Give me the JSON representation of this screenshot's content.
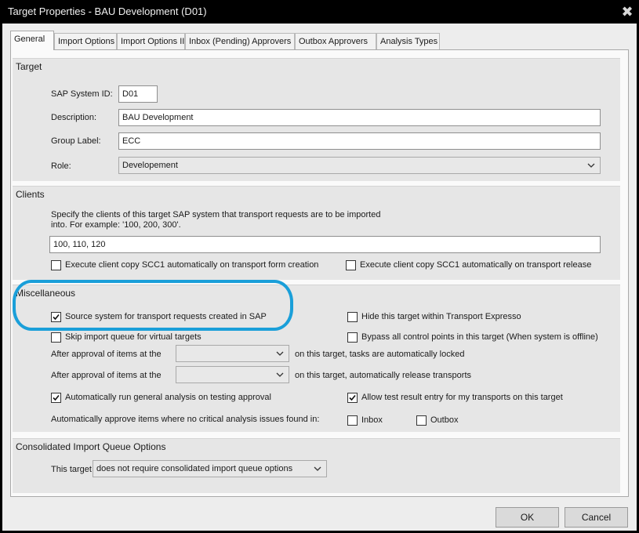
{
  "window": {
    "title": "Target Properties - BAU Development (D01)",
    "close_glyph": "✖"
  },
  "tabs": [
    {
      "label": "General",
      "active": true
    },
    {
      "label": "Import Options"
    },
    {
      "label": "Import Options II"
    },
    {
      "label": "Inbox (Pending) Approvers"
    },
    {
      "label": "Outbox Approvers"
    },
    {
      "label": "Analysis Types"
    }
  ],
  "target": {
    "title": "Target",
    "sap_system_id": {
      "label": "SAP System ID:",
      "value": "D01"
    },
    "description": {
      "label": "Description:",
      "value": "BAU Development"
    },
    "group_label": {
      "label": "Group Label:",
      "value": "ECC"
    },
    "role": {
      "label": "Role:",
      "value": "Developement"
    }
  },
  "clients": {
    "title": "Clients",
    "help_line1": "Specify the clients of this target SAP system that transport requests are to be imported",
    "help_line2": "into.  For example: '100, 200, 300'.",
    "value": "100, 110, 120",
    "cb_copy_on_creation": {
      "label": "Execute client copy SCC1 automatically on transport form creation",
      "checked": false
    },
    "cb_copy_on_release": {
      "label": "Execute client copy SCC1 automatically on transport release",
      "checked": false
    }
  },
  "misc": {
    "title": "Miscellaneous",
    "cb_source_system": {
      "label": "Source system for transport requests created in SAP",
      "checked": true
    },
    "cb_hide_target": {
      "label": "Hide this target within Transport Expresso",
      "checked": false
    },
    "cb_skip_queue": {
      "label": "Skip import queue for virtual targets",
      "checked": false
    },
    "cb_bypass_control": {
      "label": "Bypass all control points in this target (When system is offline)",
      "checked": false
    },
    "approval_lock": {
      "prefix": "After approval of items at the",
      "value": "",
      "suffix": "on this target, tasks are automatically locked"
    },
    "approval_release": {
      "prefix": "After approval of items at the",
      "value": "",
      "suffix": "on this target, automatically release transports"
    },
    "cb_auto_analysis": {
      "label": "Automatically run general analysis on testing approval",
      "checked": true
    },
    "cb_test_result": {
      "label": "Allow test result entry for my transports on this target",
      "checked": true
    },
    "auto_approve_label": "Automatically approve items where no critical analysis issues found in:",
    "cb_inbox": {
      "label": "Inbox",
      "checked": false
    },
    "cb_outbox": {
      "label": "Outbox",
      "checked": false
    }
  },
  "consolidated": {
    "title": "Consolidated Import Queue Options",
    "label": "This target",
    "value": "does not require consolidated import queue options"
  },
  "buttons": {
    "ok": "OK",
    "cancel": "Cancel"
  },
  "colors": {
    "highlight_ring": "#1a9fd9",
    "titlebar": "#000000",
    "group_bg": "#e6e6e6"
  }
}
